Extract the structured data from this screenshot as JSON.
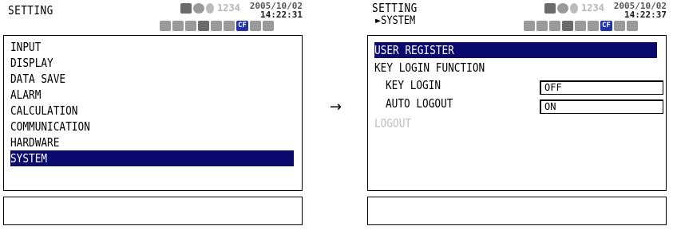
{
  "left": {
    "title": "SETTING",
    "datetime": {
      "date": "2005/10/02",
      "time": "14:22:31"
    },
    "status_number": "1234",
    "status_cf": "CF",
    "menu": [
      {
        "label": "INPUT"
      },
      {
        "label": "DISPLAY"
      },
      {
        "label": "DATA SAVE"
      },
      {
        "label": "ALARM"
      },
      {
        "label": "CALCULATION"
      },
      {
        "label": "COMMUNICATION"
      },
      {
        "label": "HARDWARE"
      },
      {
        "label": "SYSTEM",
        "selected": true
      }
    ],
    "message": ""
  },
  "transition_arrow": "→",
  "right": {
    "title": "SETTING",
    "breadcrumb": "►SYSTEM",
    "datetime": {
      "date": "2005/10/02",
      "time": "14:22:37"
    },
    "status_number": "1234",
    "status_cf": "CF",
    "menu": {
      "user_register": "USER REGISTER",
      "key_login_function": "KEY LOGIN FUNCTION",
      "key_login_label": "KEY LOGIN",
      "key_login_value": "OFF",
      "auto_logout_label": "AUTO LOGOUT",
      "auto_logout_value": "ON",
      "logout": "LOGOUT"
    },
    "message": ""
  },
  "colors": {
    "selection": "#0a0a6e",
    "disabled_text": "#bdbdbd"
  },
  "icons": [
    "printer-icon",
    "lock-icon",
    "speaker-icon",
    "usb-icon",
    "network-icon",
    "keyboard-icon",
    "display-icon",
    "cf-card-icon",
    "document-icon",
    "key-icon"
  ]
}
